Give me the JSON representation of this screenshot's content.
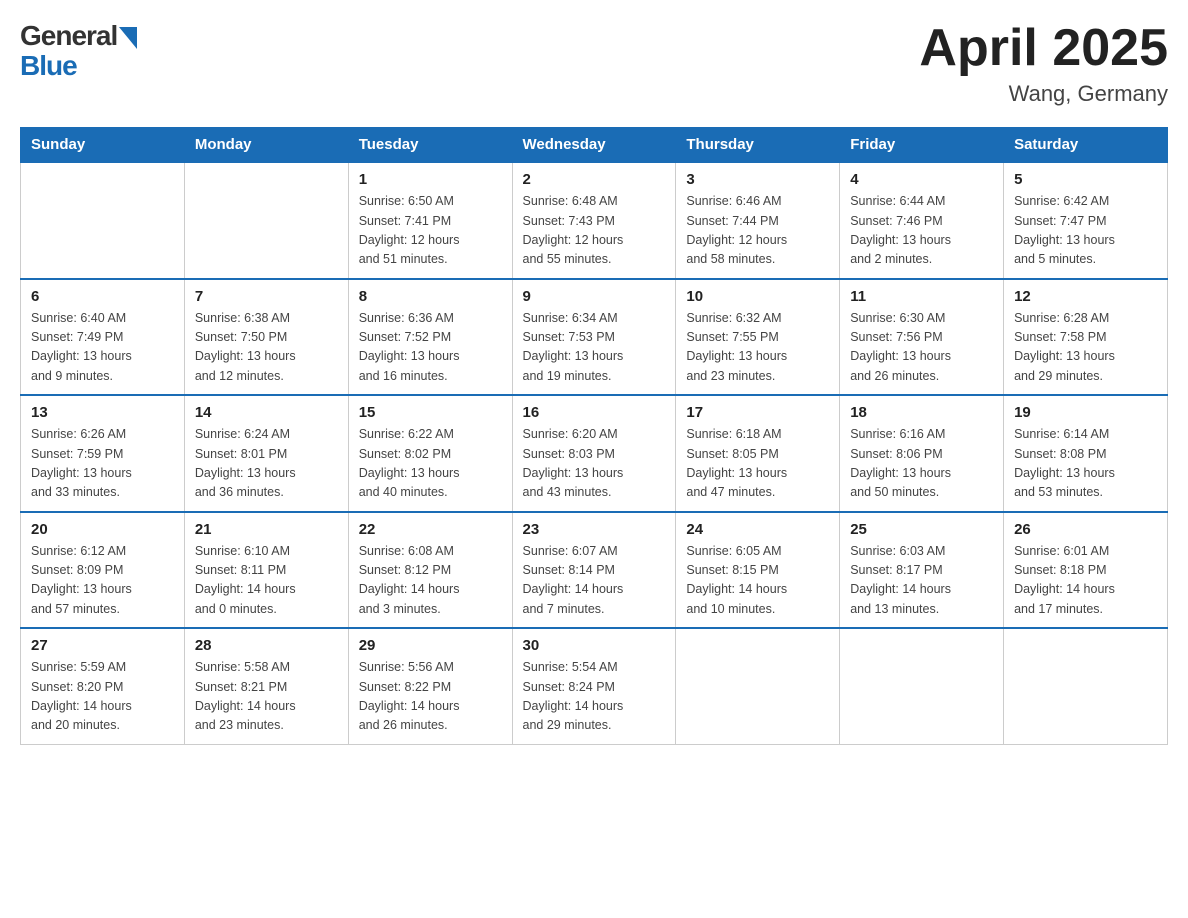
{
  "header": {
    "logo_general": "General",
    "logo_blue": "Blue",
    "month_title": "April 2025",
    "location": "Wang, Germany"
  },
  "weekdays": [
    "Sunday",
    "Monday",
    "Tuesday",
    "Wednesday",
    "Thursday",
    "Friday",
    "Saturday"
  ],
  "weeks": [
    [
      {
        "day": "",
        "info": ""
      },
      {
        "day": "",
        "info": ""
      },
      {
        "day": "1",
        "info": "Sunrise: 6:50 AM\nSunset: 7:41 PM\nDaylight: 12 hours\nand 51 minutes."
      },
      {
        "day": "2",
        "info": "Sunrise: 6:48 AM\nSunset: 7:43 PM\nDaylight: 12 hours\nand 55 minutes."
      },
      {
        "day": "3",
        "info": "Sunrise: 6:46 AM\nSunset: 7:44 PM\nDaylight: 12 hours\nand 58 minutes."
      },
      {
        "day": "4",
        "info": "Sunrise: 6:44 AM\nSunset: 7:46 PM\nDaylight: 13 hours\nand 2 minutes."
      },
      {
        "day": "5",
        "info": "Sunrise: 6:42 AM\nSunset: 7:47 PM\nDaylight: 13 hours\nand 5 minutes."
      }
    ],
    [
      {
        "day": "6",
        "info": "Sunrise: 6:40 AM\nSunset: 7:49 PM\nDaylight: 13 hours\nand 9 minutes."
      },
      {
        "day": "7",
        "info": "Sunrise: 6:38 AM\nSunset: 7:50 PM\nDaylight: 13 hours\nand 12 minutes."
      },
      {
        "day": "8",
        "info": "Sunrise: 6:36 AM\nSunset: 7:52 PM\nDaylight: 13 hours\nand 16 minutes."
      },
      {
        "day": "9",
        "info": "Sunrise: 6:34 AM\nSunset: 7:53 PM\nDaylight: 13 hours\nand 19 minutes."
      },
      {
        "day": "10",
        "info": "Sunrise: 6:32 AM\nSunset: 7:55 PM\nDaylight: 13 hours\nand 23 minutes."
      },
      {
        "day": "11",
        "info": "Sunrise: 6:30 AM\nSunset: 7:56 PM\nDaylight: 13 hours\nand 26 minutes."
      },
      {
        "day": "12",
        "info": "Sunrise: 6:28 AM\nSunset: 7:58 PM\nDaylight: 13 hours\nand 29 minutes."
      }
    ],
    [
      {
        "day": "13",
        "info": "Sunrise: 6:26 AM\nSunset: 7:59 PM\nDaylight: 13 hours\nand 33 minutes."
      },
      {
        "day": "14",
        "info": "Sunrise: 6:24 AM\nSunset: 8:01 PM\nDaylight: 13 hours\nand 36 minutes."
      },
      {
        "day": "15",
        "info": "Sunrise: 6:22 AM\nSunset: 8:02 PM\nDaylight: 13 hours\nand 40 minutes."
      },
      {
        "day": "16",
        "info": "Sunrise: 6:20 AM\nSunset: 8:03 PM\nDaylight: 13 hours\nand 43 minutes."
      },
      {
        "day": "17",
        "info": "Sunrise: 6:18 AM\nSunset: 8:05 PM\nDaylight: 13 hours\nand 47 minutes."
      },
      {
        "day": "18",
        "info": "Sunrise: 6:16 AM\nSunset: 8:06 PM\nDaylight: 13 hours\nand 50 minutes."
      },
      {
        "day": "19",
        "info": "Sunrise: 6:14 AM\nSunset: 8:08 PM\nDaylight: 13 hours\nand 53 minutes."
      }
    ],
    [
      {
        "day": "20",
        "info": "Sunrise: 6:12 AM\nSunset: 8:09 PM\nDaylight: 13 hours\nand 57 minutes."
      },
      {
        "day": "21",
        "info": "Sunrise: 6:10 AM\nSunset: 8:11 PM\nDaylight: 14 hours\nand 0 minutes."
      },
      {
        "day": "22",
        "info": "Sunrise: 6:08 AM\nSunset: 8:12 PM\nDaylight: 14 hours\nand 3 minutes."
      },
      {
        "day": "23",
        "info": "Sunrise: 6:07 AM\nSunset: 8:14 PM\nDaylight: 14 hours\nand 7 minutes."
      },
      {
        "day": "24",
        "info": "Sunrise: 6:05 AM\nSunset: 8:15 PM\nDaylight: 14 hours\nand 10 minutes."
      },
      {
        "day": "25",
        "info": "Sunrise: 6:03 AM\nSunset: 8:17 PM\nDaylight: 14 hours\nand 13 minutes."
      },
      {
        "day": "26",
        "info": "Sunrise: 6:01 AM\nSunset: 8:18 PM\nDaylight: 14 hours\nand 17 minutes."
      }
    ],
    [
      {
        "day": "27",
        "info": "Sunrise: 5:59 AM\nSunset: 8:20 PM\nDaylight: 14 hours\nand 20 minutes."
      },
      {
        "day": "28",
        "info": "Sunrise: 5:58 AM\nSunset: 8:21 PM\nDaylight: 14 hours\nand 23 minutes."
      },
      {
        "day": "29",
        "info": "Sunrise: 5:56 AM\nSunset: 8:22 PM\nDaylight: 14 hours\nand 26 minutes."
      },
      {
        "day": "30",
        "info": "Sunrise: 5:54 AM\nSunset: 8:24 PM\nDaylight: 14 hours\nand 29 minutes."
      },
      {
        "day": "",
        "info": ""
      },
      {
        "day": "",
        "info": ""
      },
      {
        "day": "",
        "info": ""
      }
    ]
  ]
}
